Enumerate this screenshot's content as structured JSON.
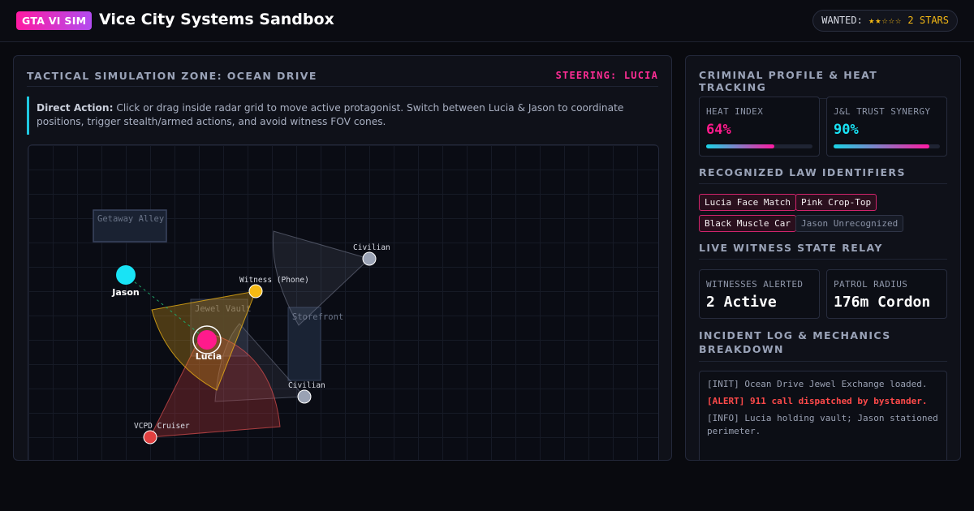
{
  "header": {
    "badge": "GTA VI SIM",
    "title": "Vice City Systems Sandbox",
    "wanted_label": "WANTED:",
    "wanted_stars": "★★☆☆☆",
    "wanted_count": "2 STARS",
    "wanted_level": 2,
    "wanted_max": 5
  },
  "simulation": {
    "title": "TACTICAL SIMULATION ZONE: OCEAN DRIVE",
    "steering": "STEERING: LUCIA",
    "direct_action_label": "Direct Action:",
    "direct_action_text": "Click or drag inside radar grid to move active protagonist. Switch between Lucia & Jason to coordinate positions, trigger stealth/armed actions, and avoid witness FOV cones.",
    "zones": [
      {
        "name": "Getaway Alley"
      },
      {
        "name": "Jewel Vault"
      },
      {
        "name": "Storefront"
      }
    ],
    "entities": [
      {
        "name": "Jason",
        "role": "protagonist"
      },
      {
        "name": "Lucia",
        "role": "protagonist-active"
      },
      {
        "name": "Witness (Phone)",
        "role": "witness-alerted"
      },
      {
        "name": "Civilian",
        "role": "civilian"
      },
      {
        "name": "Civilian",
        "role": "civilian"
      },
      {
        "name": "VCPD Cruiser",
        "role": "police"
      }
    ]
  },
  "profile": {
    "title": "CRIMINAL PROFILE & HEAT TRACKING",
    "heat": {
      "label": "HEAT INDEX",
      "value": "64%",
      "level": 0.64
    },
    "trust": {
      "label": "J&L TRUST SYNERGY",
      "value": "90%",
      "level": 0.9
    },
    "identifiers_title": "RECOGNIZED LAW IDENTIFIERS",
    "identifiers": [
      {
        "label": "Lucia Face Match",
        "state": "recognized"
      },
      {
        "label": "Pink Crop-Top",
        "state": "recognized"
      },
      {
        "label": "Black Muscle Car",
        "state": "recognized"
      },
      {
        "label": "Jason Unrecognized",
        "state": "unrecognized"
      }
    ],
    "witness_title": "LIVE WITNESS STATE RELAY",
    "witnesses": {
      "label": "WITNESSES ALERTED",
      "value": "2 Active"
    },
    "patrol": {
      "label": "PATROL RADIUS",
      "value": "176m Cordon"
    },
    "log_title": "INCIDENT LOG & MECHANICS BREAKDOWN",
    "log": [
      {
        "text": "[INIT] Ocean Drive Jewel Exchange loaded.",
        "type": "info"
      },
      {
        "text": "[ALERT] 911 call dispatched by bystander.",
        "type": "alert"
      },
      {
        "text": "[INFO] Lucia holding vault; Jason stationed perimeter.",
        "type": "info"
      }
    ]
  },
  "colors": {
    "accent_pink": "#ff1aa2",
    "accent_cyan": "#1ad4e6",
    "star_yellow": "#f5b914",
    "alert_red": "#ff4a4a"
  }
}
